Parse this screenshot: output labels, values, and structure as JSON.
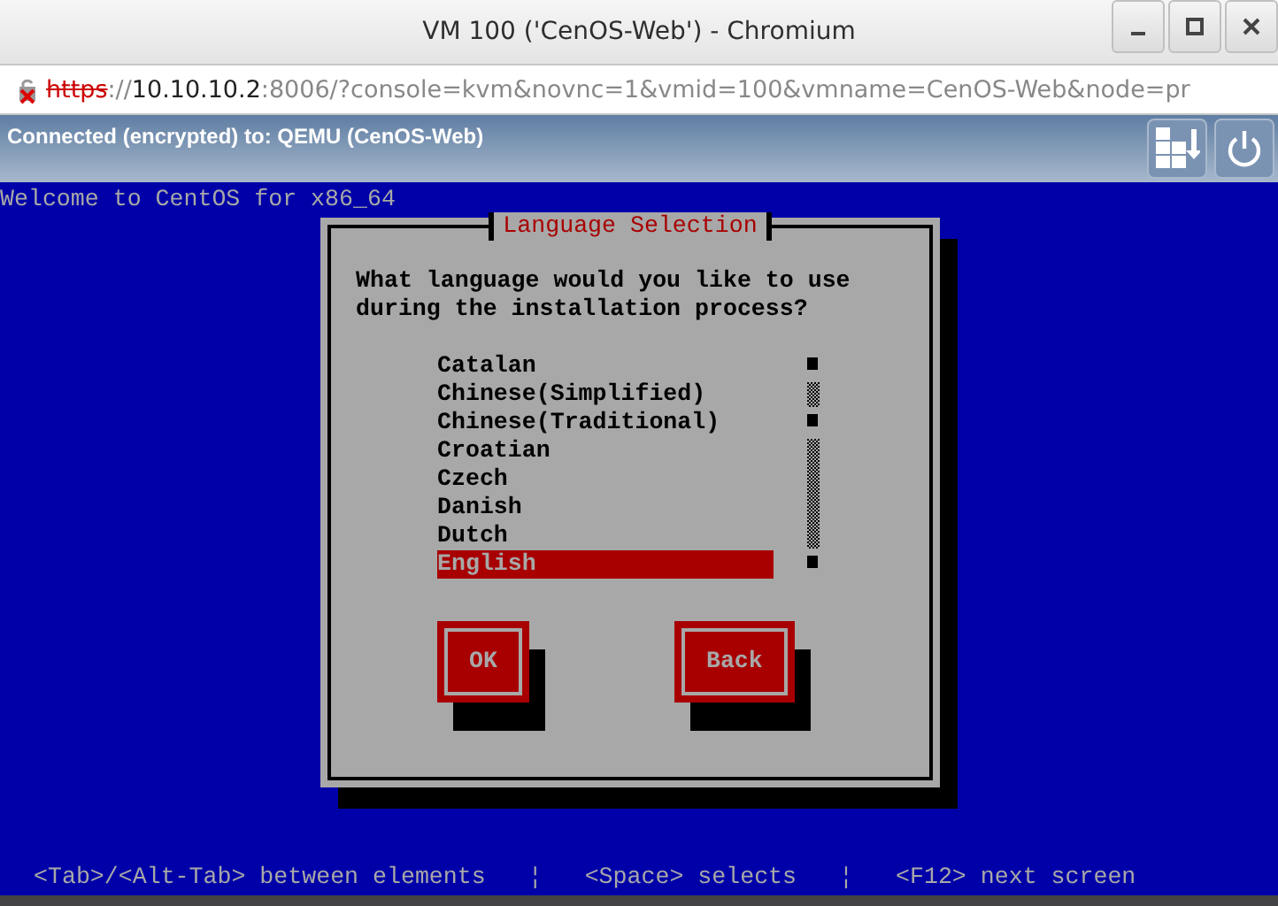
{
  "window": {
    "title": "VM 100 ('CenOS-Web') - Chromium"
  },
  "address_bar": {
    "parts": [
      {
        "kind": "scheme",
        "text": "https"
      },
      {
        "kind": "dim",
        "text": "://"
      },
      {
        "kind": "host",
        "text": "10.10.10.2"
      },
      {
        "kind": "dim",
        "text": ":8006/?console=kvm&novnc=1&vmid=100&vmname=CenOS-Web&node=pr"
      }
    ]
  },
  "vnc_bar": {
    "status": "Connected (encrypted) to: QEMU (CenOS-Web)"
  },
  "console": {
    "welcome": "Welcome to CentOS for x86_64",
    "dialog": {
      "title": "Language Selection",
      "prompt": "What language would you like to use during the installation process?",
      "languages": [
        {
          "label": "Catalan",
          "selected": false
        },
        {
          "label": "Chinese(Simplified)",
          "selected": false
        },
        {
          "label": "Chinese(Traditional)",
          "selected": false
        },
        {
          "label": "Croatian",
          "selected": false
        },
        {
          "label": "Czech",
          "selected": false
        },
        {
          "label": "Danish",
          "selected": false
        },
        {
          "label": "Dutch",
          "selected": false
        },
        {
          "label": "English",
          "selected": true
        }
      ],
      "buttons": [
        "OK",
        "Back"
      ]
    },
    "footer": [
      "<Tab>/<Alt-Tab> between elements",
      "¦",
      "<Space> selects",
      "¦",
      "<F12> next screen"
    ]
  }
}
